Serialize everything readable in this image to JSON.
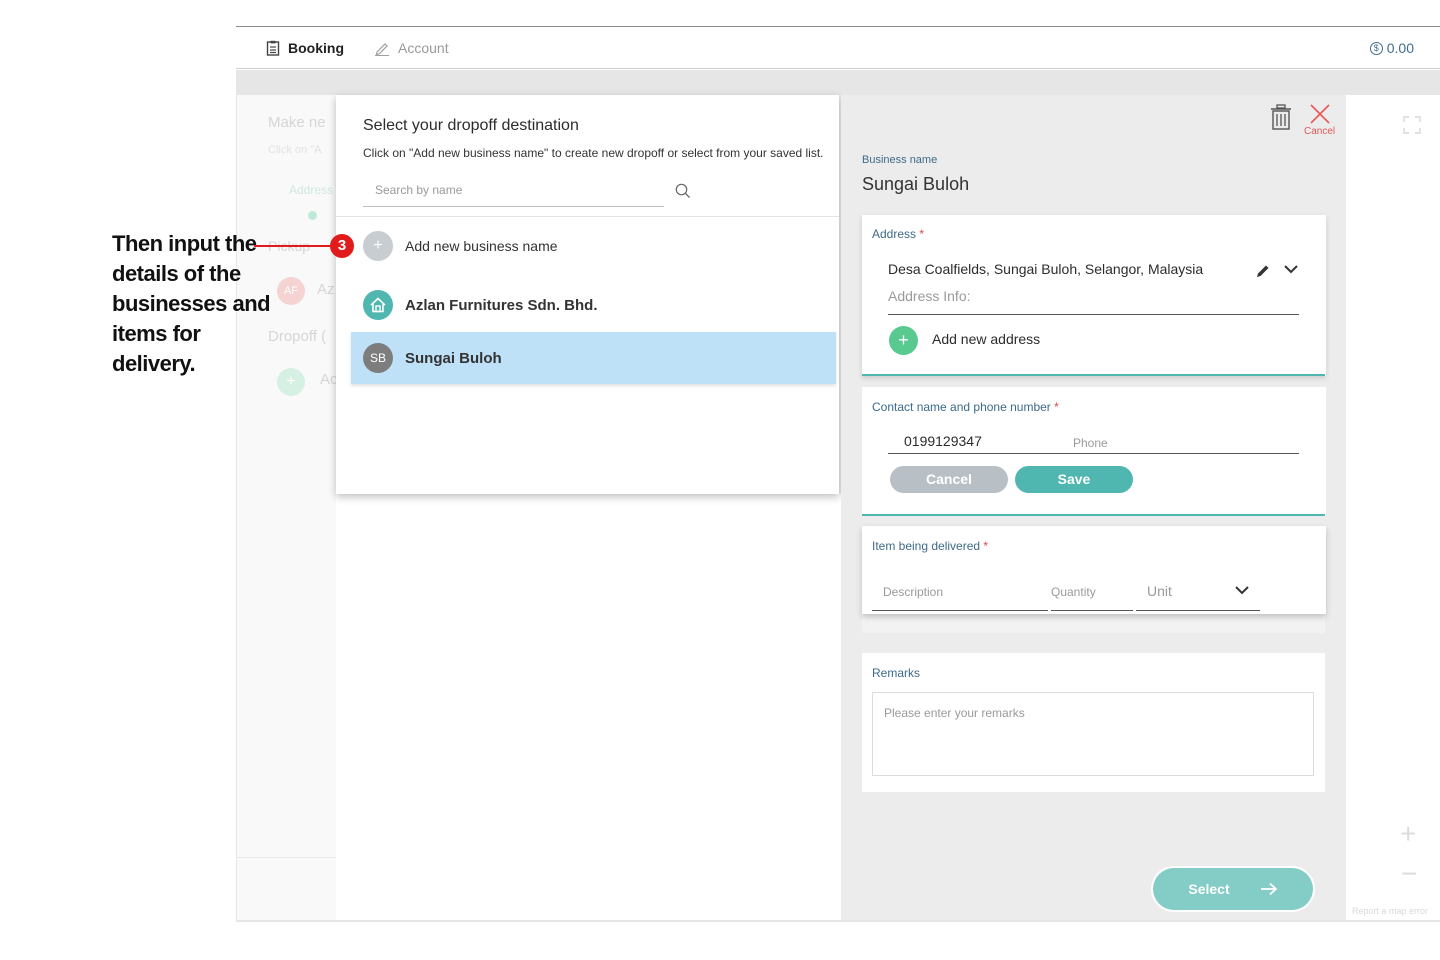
{
  "nav": {
    "booking_label": "Booking",
    "account_label": "Account",
    "balance": "0.00"
  },
  "background": {
    "make_new": "Make ne",
    "click_on": "Click on \"A",
    "address_tab": "Address",
    "pickup_label": "Pickup",
    "avatar_initials": "AF",
    "avatar_name": "Az",
    "dropoff_label": "Dropoff (",
    "add_label": "Ac",
    "report_map_error": "Report a map error"
  },
  "popup": {
    "title": "Select your dropoff destination",
    "subtitle": "Click on \"Add new business name\" to create new dropoff or select from your saved list.",
    "search_placeholder": "Search by name",
    "add_new_label": "Add new business name",
    "items": [
      {
        "name": "Azlan Furnitures Sdn. Bhd.",
        "icon": "home-icon"
      },
      {
        "name": "Sungai Buloh",
        "initials": "SB",
        "selected": true
      }
    ]
  },
  "form": {
    "cancel_label": "Cancel",
    "business_name_label": "Business name",
    "business_name_value": "Sungai Buloh",
    "address": {
      "label": "Address",
      "required_mark": "*",
      "value": "Desa Coalfields, Sungai Buloh, Selangor, Malaysia",
      "info_placeholder": "Address Info:",
      "add_new_label": "Add new address"
    },
    "contact": {
      "label": "Contact name and phone number",
      "required_mark": "*",
      "phone_value": "0199129347",
      "phone_placeholder": "Phone",
      "cancel_label": "Cancel",
      "save_label": "Save"
    },
    "item": {
      "label": "Item being delivered",
      "required_mark": "*",
      "description_placeholder": "Description",
      "quantity_placeholder": "Quantity",
      "unit_placeholder": "Unit"
    },
    "remarks": {
      "label": "Remarks",
      "placeholder": "Please enter your remarks"
    },
    "select_label": "Select"
  },
  "annotation": {
    "step": "3",
    "text": "Then input the details of the businesses and items for delivery."
  },
  "colors": {
    "teal": "#4fb6b0",
    "selected_row": "#bfe1f7",
    "annotation_red": "#e11b1b",
    "link_blue": "#3e6a8a"
  }
}
